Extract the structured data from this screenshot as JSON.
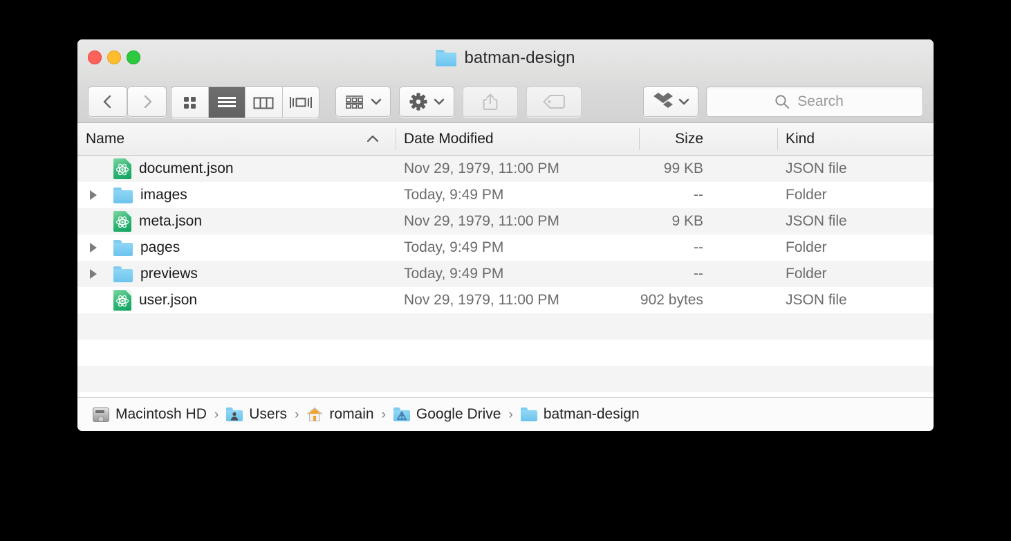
{
  "window": {
    "title": "batman-design",
    "title_icon": "folder-icon",
    "traffic_lights": [
      {
        "name": "close-button",
        "color": "#ff6259"
      },
      {
        "name": "minimize-button",
        "color": "#ffbd2e"
      },
      {
        "name": "zoom-button",
        "color": "#2dc93f"
      }
    ]
  },
  "toolbar": {
    "back_icon": "chevron-left-icon",
    "forward_icon": "chevron-right-icon",
    "view_modes": [
      {
        "name": "icon-view",
        "icon": "grid-icon",
        "active": false
      },
      {
        "name": "list-view",
        "icon": "list-icon",
        "active": true
      },
      {
        "name": "column-view",
        "icon": "columns-icon",
        "active": false
      },
      {
        "name": "gallery-view",
        "icon": "gallery-icon",
        "active": false
      }
    ],
    "arrange_icon": "arrange-grid-icon",
    "action_icon": "gear-icon",
    "share_icon": "share-icon",
    "tag_icon": "tag-icon",
    "dropbox_icon": "dropbox-icon",
    "search_icon": "search-icon",
    "search_placeholder": "Search",
    "search_value": ""
  },
  "columns": [
    {
      "id": "name",
      "label": "Name",
      "sorted": true,
      "sort_dir": "asc"
    },
    {
      "id": "date",
      "label": "Date Modified",
      "sorted": false
    },
    {
      "id": "size",
      "label": "Size",
      "sorted": false
    },
    {
      "id": "kind",
      "label": "Kind",
      "sorted": false
    }
  ],
  "files": [
    {
      "name": "document.json",
      "icon": "json-file-icon",
      "expandable": false,
      "date": "Nov 29, 1979, 11:00 PM",
      "size": "99 KB",
      "kind": "JSON file"
    },
    {
      "name": "images",
      "icon": "folder-icon",
      "expandable": true,
      "date": "Today, 9:49 PM",
      "size": "--",
      "kind": "Folder"
    },
    {
      "name": "meta.json",
      "icon": "json-file-icon",
      "expandable": false,
      "date": "Nov 29, 1979, 11:00 PM",
      "size": "9 KB",
      "kind": "JSON file"
    },
    {
      "name": "pages",
      "icon": "folder-icon",
      "expandable": true,
      "date": "Today, 9:49 PM",
      "size": "--",
      "kind": "Folder"
    },
    {
      "name": "previews",
      "icon": "folder-icon",
      "expandable": true,
      "date": "Today, 9:49 PM",
      "size": "--",
      "kind": "Folder"
    },
    {
      "name": "user.json",
      "icon": "json-file-icon",
      "expandable": false,
      "date": "Nov 29, 1979, 11:00 PM",
      "size": "902 bytes",
      "kind": "JSON file"
    }
  ],
  "path_bar": {
    "separator": "›",
    "crumbs": [
      {
        "label": "Macintosh HD",
        "icon": "hard-drive-icon"
      },
      {
        "label": "Users",
        "icon": "users-folder-icon"
      },
      {
        "label": "romain",
        "icon": "home-folder-icon"
      },
      {
        "label": "Google Drive",
        "icon": "google-drive-folder-icon"
      },
      {
        "label": "batman-design",
        "icon": "folder-icon"
      }
    ]
  },
  "colors": {
    "folder_blue": "#6cc4ee",
    "json_green": "#0fa35f",
    "selected_segment": "#626262",
    "desktop": "#000000"
  }
}
